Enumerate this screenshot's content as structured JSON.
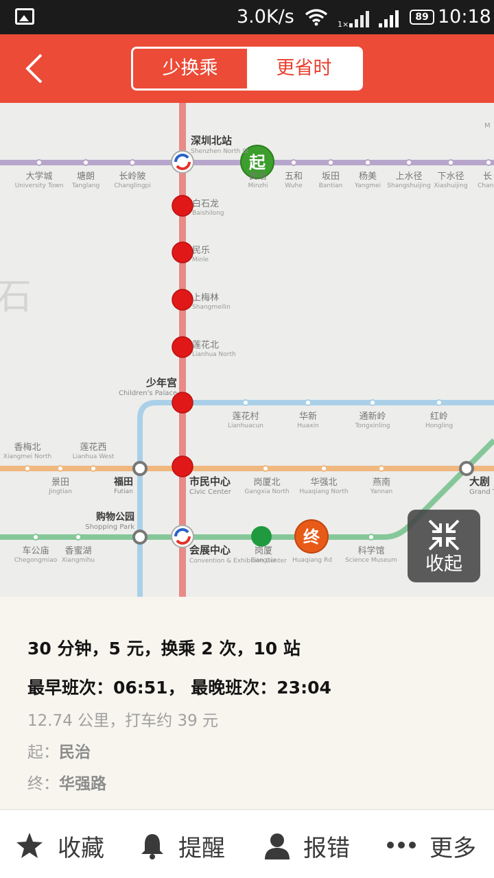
{
  "status_bar": {
    "net_speed": "3.0K/s",
    "network_sub": "1×",
    "battery": "89",
    "time": "10:18"
  },
  "header": {
    "tabs": [
      {
        "label": "少换乘",
        "active": true
      },
      {
        "label": "更省时",
        "active": false
      }
    ]
  },
  "map": {
    "stations": {
      "shenzhen_north": {
        "cn": "深圳北站",
        "en": "Shenzhen North St"
      },
      "daxuecheng": {
        "cn": "大学城",
        "en": "University Town"
      },
      "tanglang": {
        "cn": "塘朗",
        "en": "Tanglang"
      },
      "changlingpi": {
        "cn": "长岭陂",
        "en": "Changlingpi"
      },
      "minzhi": {
        "cn": "民治",
        "en": "Minzhi"
      },
      "wuhe": {
        "cn": "五和",
        "en": "Wuhe"
      },
      "bantian": {
        "cn": "坂田",
        "en": "Bantian"
      },
      "yangmei": {
        "cn": "杨美",
        "en": "Yangmei"
      },
      "shangshuijing": {
        "cn": "上水径",
        "en": "Shangshuijing"
      },
      "xiashuijing": {
        "cn": "下水径",
        "en": "Xiashuijing"
      },
      "chang": {
        "cn": "长",
        "en": "Chang"
      },
      "baishilong": {
        "cn": "白石龙",
        "en": "Baishilong"
      },
      "minle": {
        "cn": "民乐",
        "en": "Minle"
      },
      "shangmeilin": {
        "cn": "上梅林",
        "en": "Shangmeilin"
      },
      "lianhua_north": {
        "cn": "莲花北",
        "en": "Lianhua North"
      },
      "childrens_palace": {
        "cn": "少年宫",
        "en": "Children's Palace"
      },
      "lianhuacun": {
        "cn": "莲花村",
        "en": "Lianhuacun"
      },
      "huaxin": {
        "cn": "华新",
        "en": "Huaxin"
      },
      "tongxinling": {
        "cn": "通新岭",
        "en": "Tongxinling"
      },
      "hongling": {
        "cn": "红岭",
        "en": "Hongling"
      },
      "xiangmei_north": {
        "cn": "香梅北",
        "en": "Xiangmei North"
      },
      "lianhua_west": {
        "cn": "莲花西",
        "en": "Lianhua West"
      },
      "jingtian": {
        "cn": "景田",
        "en": "Jingtian"
      },
      "futian": {
        "cn": "福田",
        "en": "Futian"
      },
      "civic_center": {
        "cn": "市民中心",
        "en": "Civic Center"
      },
      "gangxia_north": {
        "cn": "岗厦北",
        "en": "Gangxia North"
      },
      "huaqiang_north": {
        "cn": "华强北",
        "en": "Huaqiang North"
      },
      "yannan": {
        "cn": "燕南",
        "en": "Yannan"
      },
      "grand_theater": {
        "cn": "大剧",
        "en": "Grand T"
      },
      "shopping_park": {
        "cn": "购物公园",
        "en": "Shopping Park"
      },
      "chegongmiao": {
        "cn": "车公庙",
        "en": "Chegongmiao"
      },
      "xiangmihu": {
        "cn": "香蜜湖",
        "en": "Xiangmihu"
      },
      "convention_center": {
        "cn": "会展中心",
        "en": "Convention & Exhibition Center"
      },
      "gangxia": {
        "cn": "岗厦",
        "en": "Gangxia"
      },
      "huaqiang_road": {
        "cn": "华强路",
        "en": "Huaqiang Rd"
      },
      "science_museum": {
        "cn": "科学馆",
        "en": "Science Museum"
      }
    },
    "start_marker": "起",
    "end_marker": "终",
    "collapse_label": "收起",
    "colors": {
      "line4_route": "#e88a86",
      "line5_purple": "#b7a6cc",
      "line9_blue": "#a9d0e8",
      "line2_orange": "#f0b77e",
      "line1_green": "#86c79a",
      "route_station": "#e01818",
      "start_green": "#3c9e2c",
      "end_orange": "#e85a18"
    }
  },
  "route_info": {
    "summary": "30 分钟，5 元，换乘 2 次，10 站",
    "schedule": "最早班次：06:51， 最晚班次：23:04",
    "distance": "12.74 公里，打车约 39 元",
    "start_prefix": "起：",
    "start_station": "民治",
    "end_prefix": "终：",
    "end_station": "华强路"
  },
  "actions": [
    {
      "label": "收藏",
      "icon": "star-icon"
    },
    {
      "label": "提醒",
      "icon": "bell-icon"
    },
    {
      "label": "报错",
      "icon": "person-icon"
    },
    {
      "label": "更多",
      "icon": "more-dots-icon"
    }
  ]
}
